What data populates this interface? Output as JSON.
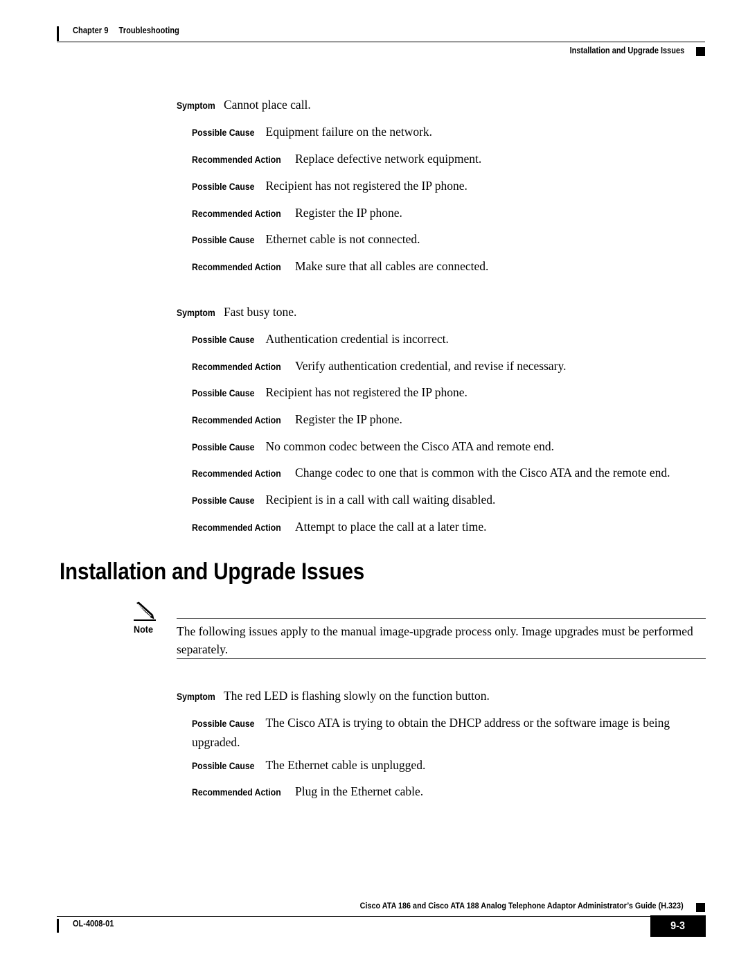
{
  "header": {
    "chapter_number": "Chapter 9",
    "chapter_title": "Troubleshooting",
    "running_head": "Installation and Upgrade Issues"
  },
  "labels": {
    "symptom": "Symptom",
    "possible_cause": "Possible Cause",
    "recommended_action": "Recommended Action",
    "note": "Note"
  },
  "section": {
    "heading": "Installation and Upgrade Issues"
  },
  "note": {
    "icon": "pencil-icon",
    "label": "Note",
    "text": "The following issues apply to the manual image-upgrade process only. Image upgrades must be performed separately."
  },
  "entries": {
    "e1_symptom": "Cannot place call.",
    "e1_cause1": "Equipment failure on the network.",
    "e1_action1": "Replace defective network equipment.",
    "e1_cause2": "Recipient has not registered the IP phone.",
    "e1_action2": "Register the IP phone.",
    "e1_cause3": "Ethernet cable is not connected.",
    "e1_action3": "Make sure that all cables are connected.",
    "e2_symptom": "Fast busy tone.",
    "e2_cause1": "Authentication credential is incorrect.",
    "e2_action1": "Verify authentication credential, and revise if necessary.",
    "e2_cause2": "Recipient has not registered the IP phone.",
    "e2_action2": "Register the IP phone.",
    "e2_cause3": "No common codec between the Cisco ATA and remote end.",
    "e2_action3": "Change codec to one that is common with the Cisco ATA and the remote end.",
    "e2_cause4": "Recipient is in a call with call waiting disabled.",
    "e2_action4": "Attempt to place the call at a later time.",
    "e3_symptom": "The red LED is flashing slowly on the function button.",
    "e3_cause1": "The Cisco ATA is trying to obtain the DHCP address or the software image is being upgraded.",
    "e3_cause2": "The Ethernet cable is unplugged.",
    "e3_action1": "Plug in the Ethernet cable."
  },
  "footer": {
    "guide_title": "Cisco ATA 186 and Cisco ATA 188 Analog Telephone Adaptor Administrator’s Guide (H.323)",
    "doc_id": "OL-4008-01",
    "page_number": "9-3"
  },
  "colors": {
    "text": "#000000",
    "background": "#ffffff",
    "rule": "#000000",
    "note_rule": "#555555"
  }
}
